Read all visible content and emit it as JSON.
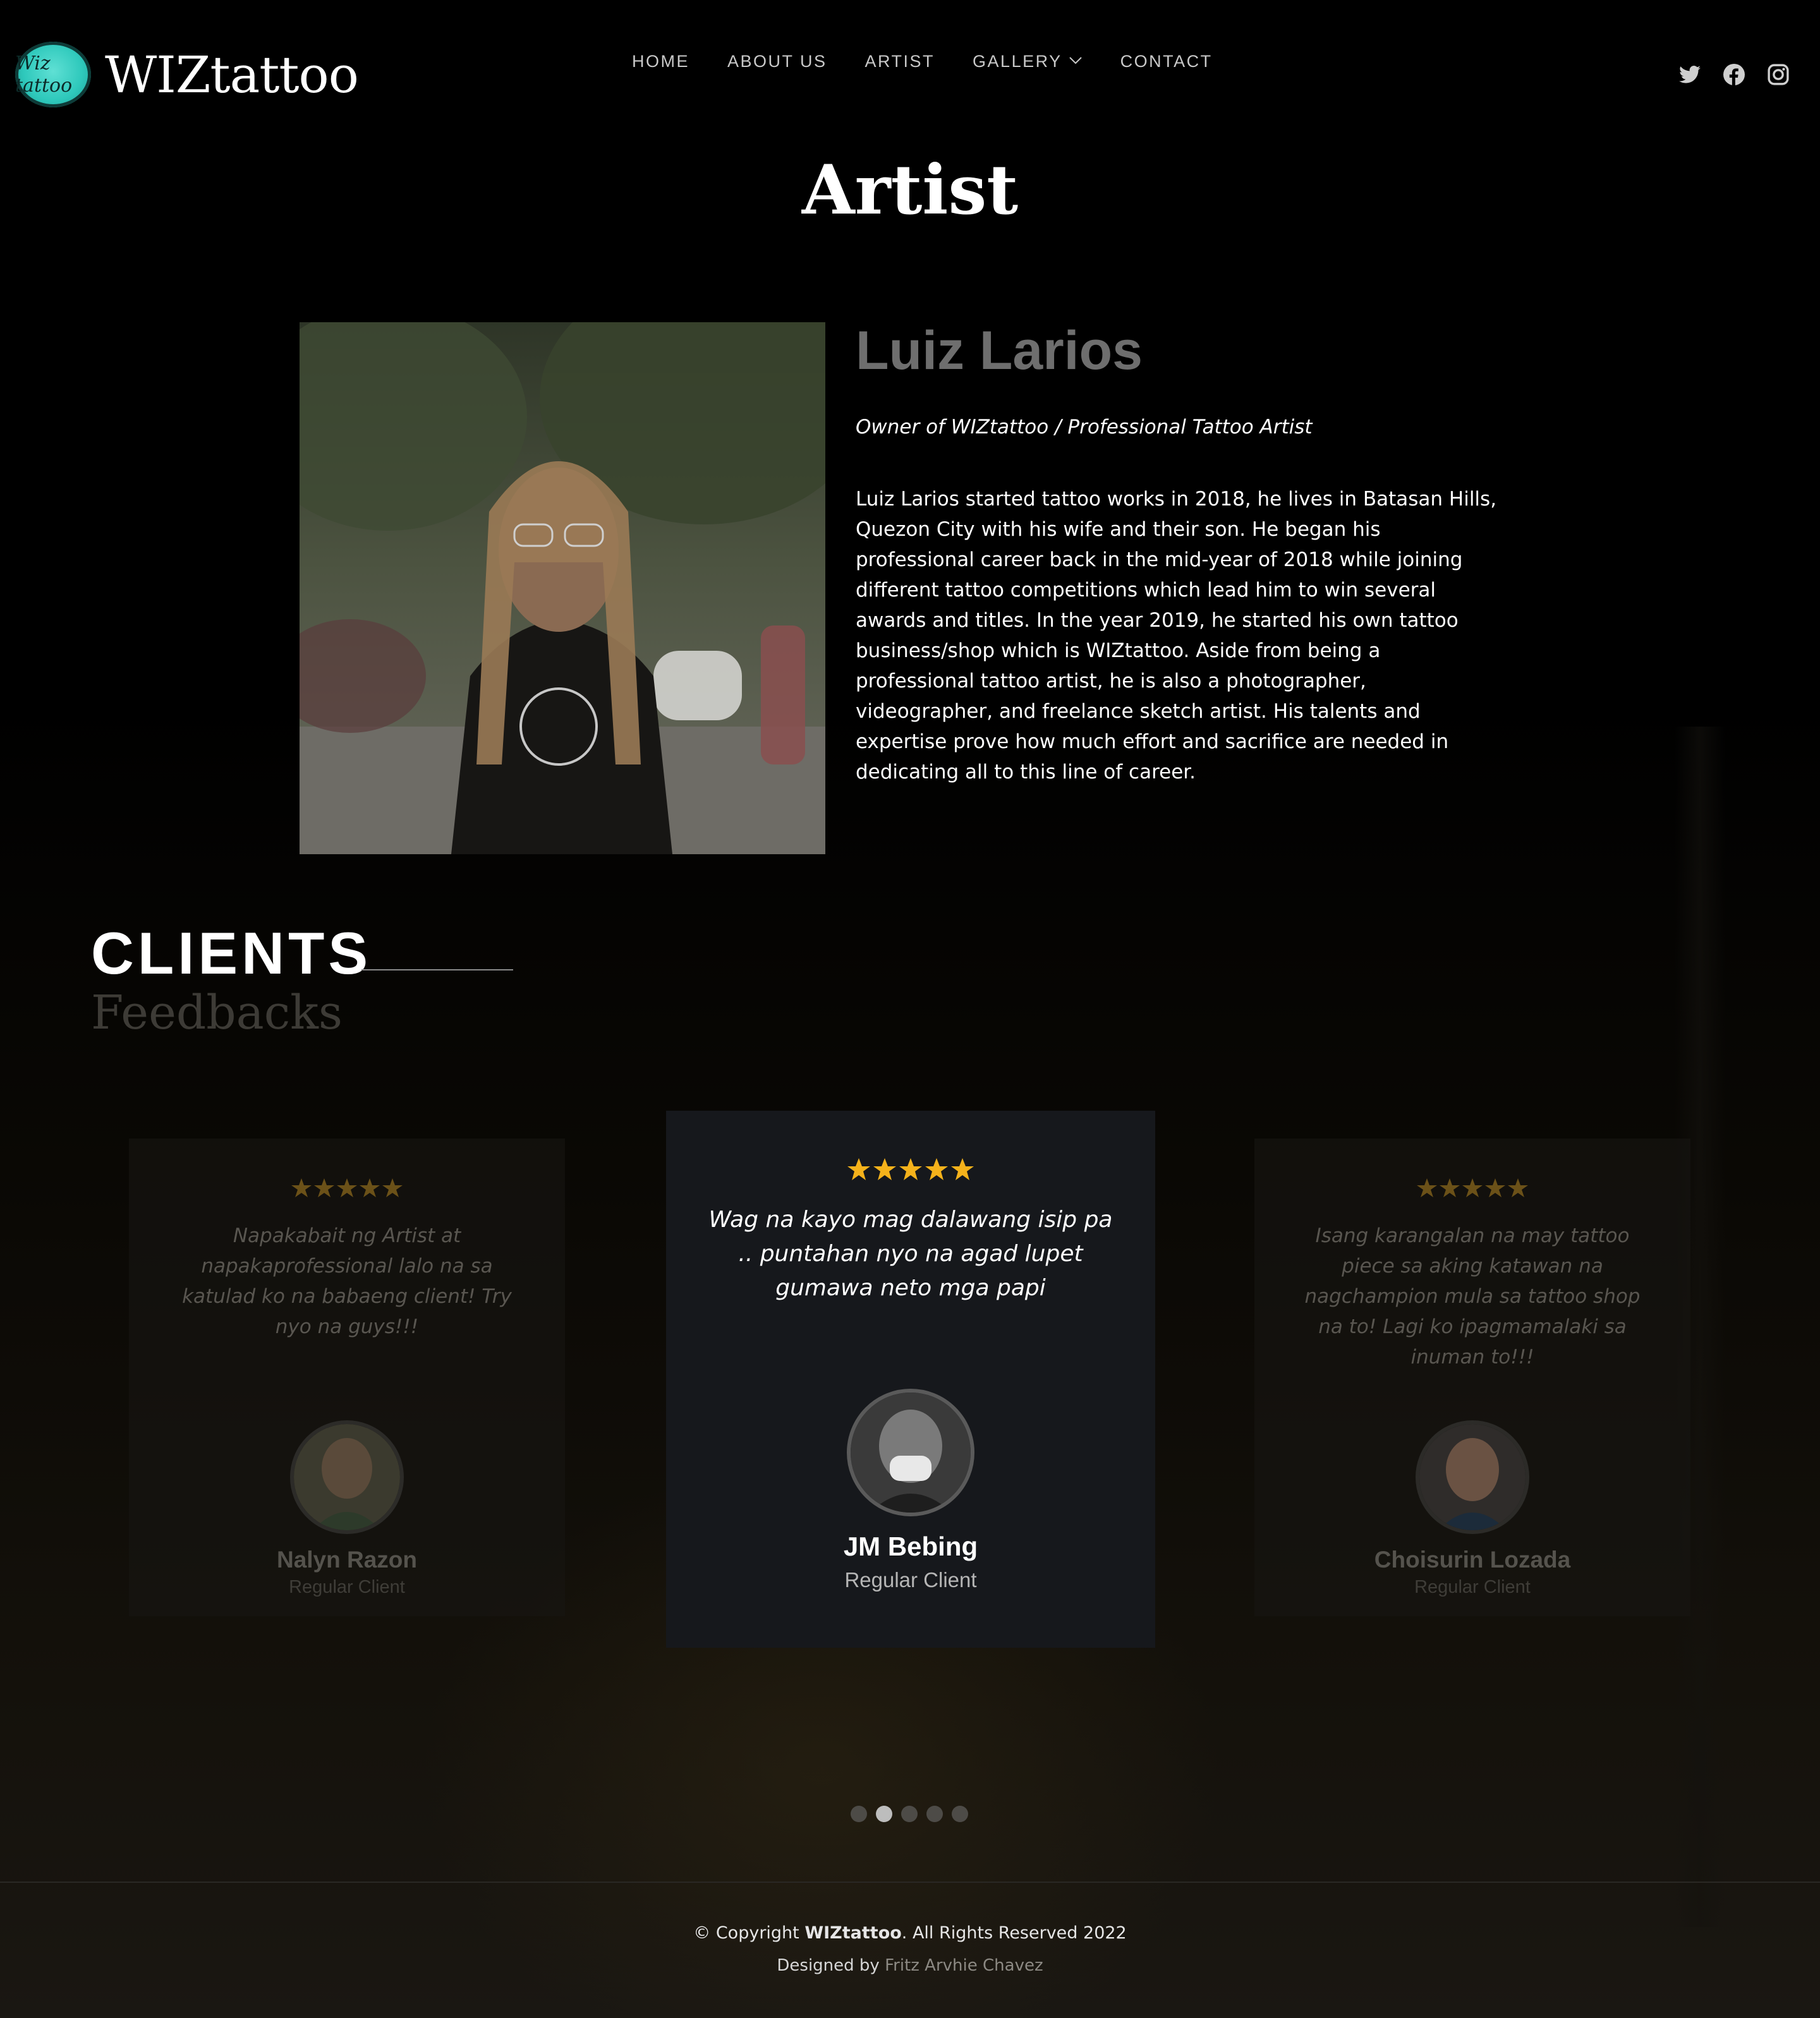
{
  "brand": {
    "logo_badge_text": "Wiz tattoo",
    "name": "WIZtattoo",
    "accent_color": "#2fc9bc"
  },
  "nav": {
    "items": [
      {
        "label": "HOME"
      },
      {
        "label": "ABOUT US"
      },
      {
        "label": "ARTIST"
      },
      {
        "label": "GALLERY",
        "has_dropdown": true
      },
      {
        "label": "CONTACT"
      }
    ]
  },
  "social": {
    "icons": [
      "twitter-icon",
      "facebook-icon",
      "instagram-icon"
    ]
  },
  "page": {
    "title": "Artist"
  },
  "artist": {
    "name": "Luiz Larios",
    "role": "Owner of WIZtattoo / Professional Tattoo Artist",
    "bio": "Luiz Larios started tattoo works in 2018, he lives in Batasan Hills, Quezon City with his wife and their son. He began his professional career back in the mid-year of 2018 while joining different tattoo competitions which lead him to win several awards and titles. In the year 2019, he started his own tattoo business/shop which is WIZtattoo. Aside from being a professional tattoo artist, he is also a photographer, videographer, and freelance sketch artist. His talents and expertise prove how much effort and sacrifice are needed in dedicating all to this line of career."
  },
  "clients": {
    "title": "CLIENTS",
    "subtitle": "Feedbacks",
    "star_color": "#f5b21b",
    "testimonials": [
      {
        "rating": 5,
        "quote": "Napakabait ng Artist at napakaprofessional lalo na sa katulad ko na babaeng client! Try nyo na guys!!!",
        "name": "Nalyn Razon",
        "type": "Regular Client"
      },
      {
        "rating": 5,
        "quote": "Wag na kayo mag dalawang isip pa .. puntahan nyo na agad lupet gumawa neto mga papi",
        "name": "JM Bebing",
        "type": "Regular Client"
      },
      {
        "rating": 5,
        "quote": "Isang karangalan na may tattoo piece sa aking katawan na nagchampion mula sa tattoo shop na to! Lagi ko ipagmamalaki sa inuman to!!!",
        "name": "Choisurin Lozada",
        "type": "Regular Client"
      }
    ],
    "pagination": {
      "count": 5,
      "active_index": 1
    }
  },
  "footer": {
    "copyright_prefix": "© Copyright ",
    "copyright_brand": "WIZtattoo",
    "copyright_suffix": ". All Rights Reserved 2022",
    "designed_by_label": "Designed by ",
    "designer": "Fritz Arvhie Chavez"
  }
}
